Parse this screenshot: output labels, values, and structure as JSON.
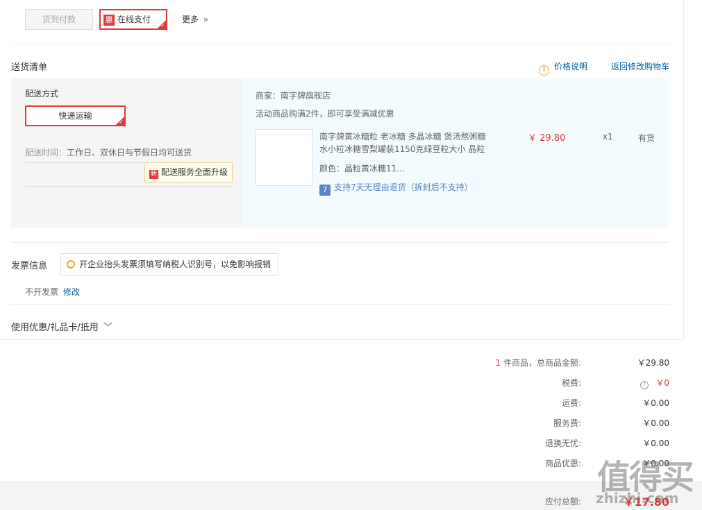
{
  "payment": {
    "cod_label": "货到付款",
    "hui_badge": "惠",
    "online_label": "在线支付",
    "more_label": "更多",
    "more_chevron": "»"
  },
  "delivery": {
    "title": "送货清单",
    "price_note": "价格说明",
    "back_to_cart": "返回修改购物车",
    "method_title": "配送方式",
    "express_label": "快递运输",
    "time_label": "配送时间：",
    "time_value": "工作日、双休日与节假日均可送货",
    "upgrade_badge": "新",
    "upgrade_tip": "配送服务全面升级"
  },
  "order": {
    "shop_label": "商家：",
    "shop_name": "南字牌旗舰店",
    "promo": "活动商品购满2件，即可享受满减优惠",
    "product_line1": "南字牌黄冰糖粒 老冰糖 多晶冰糖 煲汤熬粥糖",
    "product_line2": "水小粒冰糖雪梨罐装1150克绿豆粒大小 晶粒",
    "color_label": "颜色：",
    "color_value": "晶粒黄冰糖11...",
    "return_icon": "7",
    "return_text": "支持7天无理由退货（拆封后不支持）",
    "price": "￥ 29.80",
    "qty": "x1",
    "stock": "有货"
  },
  "invoice": {
    "title": "发票信息",
    "tip": "开企业抬头发票须填写纳税人识别号，以免影响报销",
    "status": "不开发票",
    "edit": "修改"
  },
  "coupon": {
    "title": "使用优惠/礼品卡/抵用",
    "chevron": "﹀"
  },
  "summary": {
    "count": "1",
    "count_suffix": "件商品，总商品金额:",
    "total_goods": "￥29.80",
    "tax_label": "税费:",
    "tax_value": "￥0",
    "shipping_label": "运费:",
    "shipping_value": "￥0.00",
    "service_label": "服务费:",
    "service_value": "￥0.00",
    "return_label": "退换无忧:",
    "return_value": "￥0.00",
    "discount_label": "商品优惠:",
    "discount_value": "￥0.00",
    "payable_label": "应付总额:",
    "payable_value": "￥17.80"
  },
  "watermark": {
    "text": "值得买",
    "url": "zhizhi.com"
  },
  "colors": {
    "accent": "#e4393c",
    "link": "#005ea7"
  }
}
